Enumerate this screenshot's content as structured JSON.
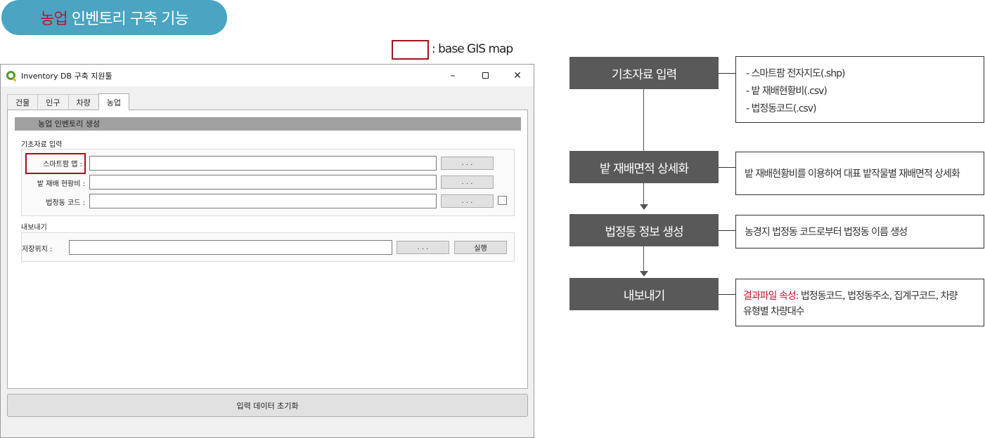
{
  "header": {
    "accent": "농업",
    "title": "인벤토리 구축 기능"
  },
  "legend": {
    "label": ": base GIS map"
  },
  "window": {
    "title": "Inventory DB 구축 지원툴",
    "controls": {
      "minimize": "–",
      "close": "✕"
    },
    "tabs": [
      "건물",
      "인구",
      "차량",
      "농업"
    ],
    "active_tab": "농업",
    "section_title": "농업 인벤토리 생성",
    "input_group": {
      "label": "기초자료 입력",
      "rows": [
        {
          "label": "스마트팜 맵 :",
          "button": ". . ."
        },
        {
          "label": "밭 재배 현황비 :",
          "button": ". . ."
        },
        {
          "label": "법정동 코드 :",
          "button": ". . ."
        }
      ]
    },
    "export_group": {
      "label": "내보내기",
      "save_label": "저장위치 :",
      "browse_button": ". . .",
      "run_button": "실행"
    },
    "reset_button": "입력 데이터 초기화"
  },
  "flow": {
    "steps": [
      {
        "title": "기초자료 입력",
        "desc_lines": [
          "- 스마트팜 전자지도(.shp)",
          "- 밭 재배현황비(.csv)",
          "- 법정동코드(.csv)"
        ]
      },
      {
        "title": "밭 재배면적 상세화",
        "desc_lines": [
          "밭 재배현황비를 이용하여 대표 밭작물별 재배면적 상세화"
        ]
      },
      {
        "title": "법정동 정보 생성",
        "desc_lines": [
          "농경지 법정동 코드로부터 법정동 이름 생성"
        ]
      },
      {
        "title": "내보내기",
        "desc_accent": "결과파일 속성:",
        "desc_rest": " 법정동코드, 법정동주소, 집계구코드, 차량",
        "desc_line2": "유형별 차량대수"
      }
    ]
  },
  "colors": {
    "accent_red": "#c8102e",
    "pill": "#4aa4c2",
    "flow_box": "#595959"
  }
}
